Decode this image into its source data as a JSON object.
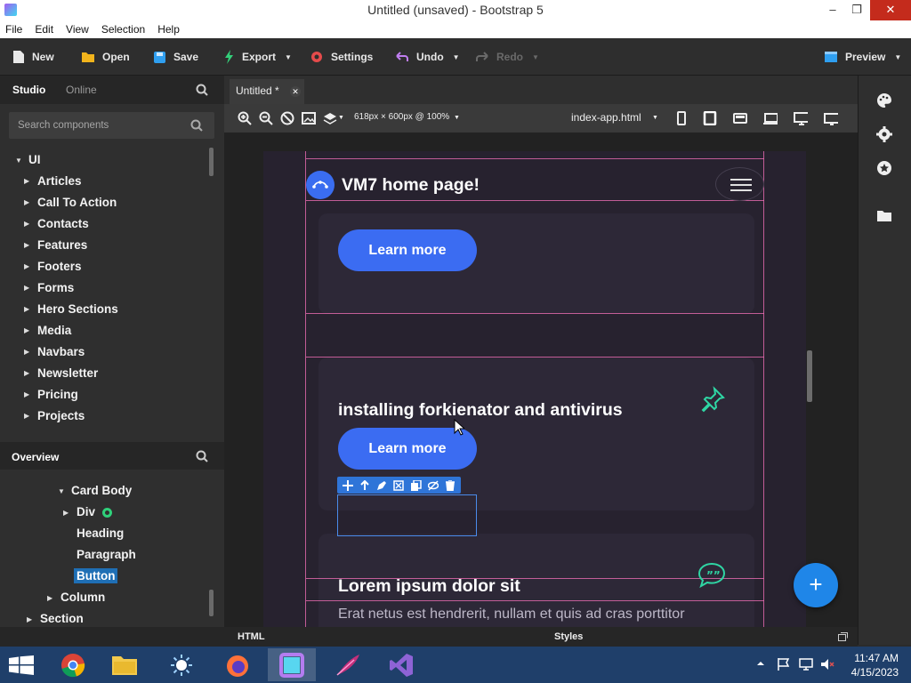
{
  "window": {
    "title": "Untitled (unsaved) - Bootstrap 5"
  },
  "menu": [
    "File",
    "Edit",
    "View",
    "Selection",
    "Help"
  ],
  "toolbar": {
    "new": "New",
    "open": "Open",
    "save": "Save",
    "export": "Export",
    "settings": "Settings",
    "undo": "Undo",
    "redo": "Redo",
    "preview": "Preview"
  },
  "left_panel": {
    "tabs": [
      "Studio",
      "Online"
    ],
    "search_placeholder": "Search components",
    "tree_root": "UI",
    "tree_items": [
      "Articles",
      "Call To Action",
      "Contacts",
      "Features",
      "Footers",
      "Forms",
      "Hero Sections",
      "Media",
      "Navbars",
      "Newsletter",
      "Pricing",
      "Projects"
    ],
    "overview_label": "Overview",
    "overview_items": [
      "Card Body",
      "Div",
      "Heading",
      "Paragraph",
      "Button",
      "Column",
      "Section"
    ]
  },
  "canvas": {
    "tab_label": "Untitled *",
    "size_readout": "618px × 600px @ 100%",
    "file_name": "index-app.html"
  },
  "preview": {
    "brand": "VM7 home page!",
    "card1_button": "Learn more",
    "card2_title": "installing forkienator and antivirus",
    "card2_button": "Learn more",
    "card3_title": "Lorem ipsum dolor sit",
    "card3_text": "Erat netus est hendrerit, nullam et quis ad cras porttitor"
  },
  "bottom": {
    "html_label": "HTML",
    "styles_label": "Styles"
  },
  "taskbar": {
    "time": "11:47 AM",
    "date": "4/15/2023"
  },
  "colors": {
    "accent": "#3b6cf2",
    "fab": "#1f86e8",
    "selection": "#1f6fb5",
    "guide": "#e86bb0",
    "icon_green": "#2fd07a"
  }
}
